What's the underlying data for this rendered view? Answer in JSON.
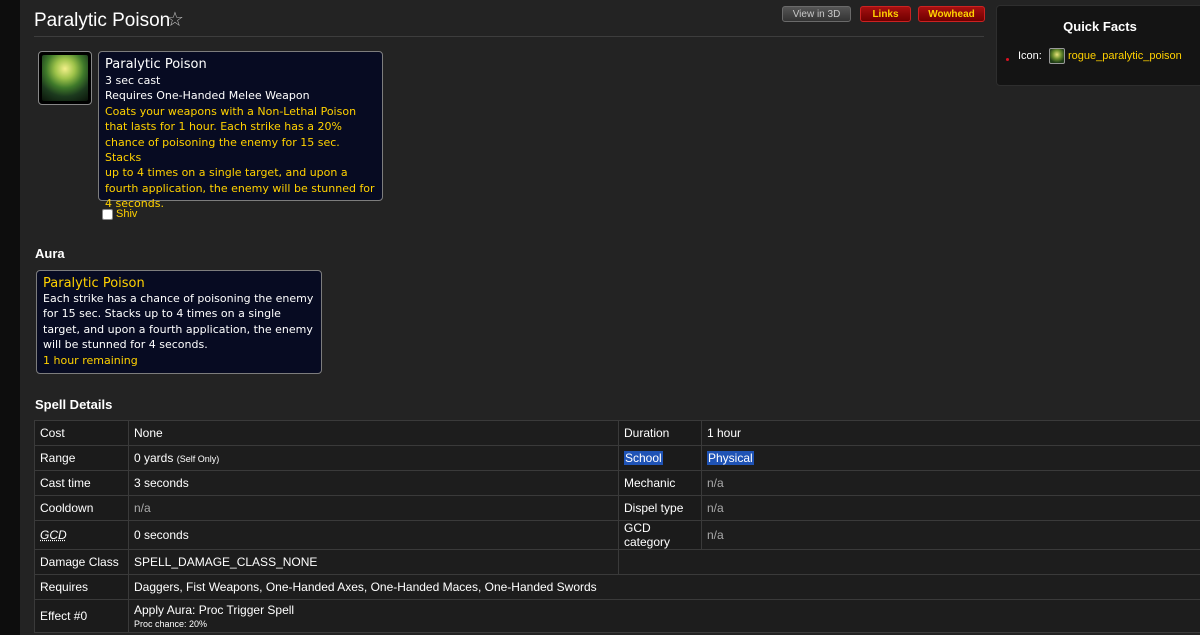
{
  "page": {
    "title": "Paralytic Poison"
  },
  "toolbar": {
    "view3d": "View in 3D",
    "links": "Links",
    "wowhead": "Wowhead"
  },
  "quick_facts": {
    "title": "Quick Facts",
    "icon_label": "Icon:",
    "icon_name": "rogue_paralytic_poison"
  },
  "tooltip": {
    "name": "Paralytic Poison",
    "cast": "3 sec cast",
    "requires": "Requires One-Handed Melee Weapon",
    "description_lines": [
      "Coats your weapons with a Non-Lethal Poison",
      "that lasts for 1 hour. Each strike has a 20%",
      "chance of poisoning the enemy for 15 sec. Stacks",
      "up to 4 times on a single target, and upon a",
      "fourth application, the enemy will be stunned for",
      "4 seconds."
    ]
  },
  "shiv": {
    "label": "Shiv"
  },
  "aura": {
    "heading": "Aura",
    "name": "Paralytic Poison",
    "lines": [
      "Each strike has a chance of poisoning the enemy",
      "for 15 sec. Stacks up to 4 times on a single",
      "target, and upon a fourth application, the enemy",
      "will be stunned for 4 seconds."
    ],
    "remaining": "1 hour remaining"
  },
  "details": {
    "heading": "Spell Details",
    "cost_label": "Cost",
    "cost": "None",
    "duration_label": "Duration",
    "duration": "1 hour",
    "range_label": "Range",
    "range": "0 yards",
    "range_note": "(Self Only)",
    "school_label": "School",
    "school": "Physical",
    "cast_time_label": "Cast time",
    "cast_time": "3 seconds",
    "mechanic_label": "Mechanic",
    "mechanic": "n/a",
    "cooldown_label": "Cooldown",
    "cooldown": "n/a",
    "dispel_label": "Dispel type",
    "dispel": "n/a",
    "gcd_label": "GCD",
    "gcd": "0 seconds",
    "gcd_category_label": "GCD category",
    "gcd_category": "n/a",
    "damage_class_label": "Damage Class",
    "damage_class": "SPELL_DAMAGE_CLASS_NONE",
    "requires_label": "Requires",
    "requires": "Daggers, Fist Weapons, One-Handed Axes, One-Handed Maces, One-Handed Swords",
    "effect_label": "Effect #0",
    "effect": "Apply Aura: Proc Trigger Spell",
    "effect_sub": "Proc chance: 20%"
  }
}
